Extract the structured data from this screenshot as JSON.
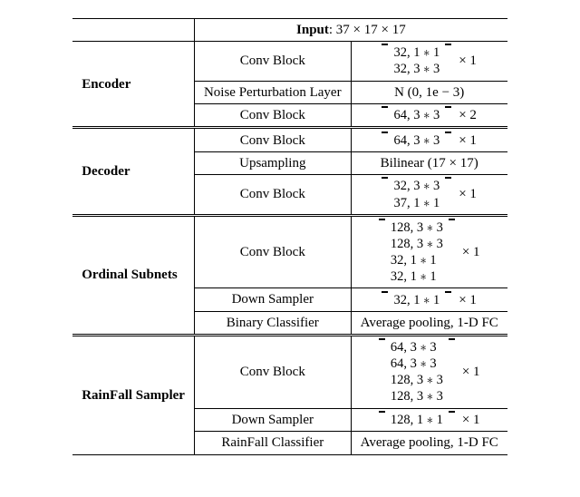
{
  "header": {
    "input_label": "Input",
    "input_dims": ": 37 × 17 × 17"
  },
  "sections": {
    "encoder": {
      "title": "Encoder",
      "rows": [
        {
          "op": "Conv Block",
          "mx": [
            "32, 1 ∗ 1",
            "32, 3 ∗ 3"
          ],
          "mult": "× 1"
        },
        {
          "op": "Noise Perturbation Layer",
          "txt": "N (0, 1e − 3)"
        },
        {
          "op": "Conv Block",
          "mx": [
            "64, 3 ∗ 3"
          ],
          "mult": "× 2"
        }
      ]
    },
    "decoder": {
      "title": "Decoder",
      "rows": [
        {
          "op": "Conv Block",
          "mx": [
            "64, 3 ∗ 3"
          ],
          "mult": "× 1"
        },
        {
          "op": "Upsampling",
          "txt": "Bilinear (17 × 17)"
        },
        {
          "op": "Conv Block",
          "mx": [
            "32, 3 ∗ 3",
            "37, 1 ∗ 1"
          ],
          "mult": "× 1"
        }
      ]
    },
    "ordinal": {
      "title": "Ordinal Subnets",
      "rows": [
        {
          "op": "Conv Block",
          "mx": [
            "128, 3 ∗ 3",
            "128, 3 ∗ 3",
            "32,  1 ∗ 1",
            "32,  1 ∗ 1"
          ],
          "mult": "× 1"
        },
        {
          "op": "Down Sampler",
          "mx": [
            "32, 1 ∗ 1"
          ],
          "mult": "× 1"
        },
        {
          "op": "Binary Classifier",
          "txt": "Average pooling, 1-D FC"
        }
      ]
    },
    "rainfall": {
      "title": "RainFall Sampler",
      "rows": [
        {
          "op": "Conv Block",
          "mx": [
            "64,  3 ∗ 3",
            "64,  3 ∗ 3",
            "128, 3 ∗ 3",
            "128, 3 ∗ 3"
          ],
          "mult": "× 1"
        },
        {
          "op": "Down Sampler",
          "mx": [
            "128, 1 ∗ 1"
          ],
          "mult": "× 1"
        },
        {
          "op": "RainFall Classifier",
          "txt": "Average pooling, 1-D FC"
        }
      ]
    }
  },
  "chart_data": {
    "type": "table",
    "title": "Network architecture table",
    "input": "37 × 17 × 17",
    "sections": [
      {
        "name": "Encoder",
        "layers": [
          {
            "op": "Conv Block",
            "kernels": [
              [
                32,
                "1*1"
              ],
              [
                32,
                "3*3"
              ]
            ],
            "repeat": 1
          },
          {
            "op": "Noise Perturbation Layer",
            "detail": "N(0, 1e-3)"
          },
          {
            "op": "Conv Block",
            "kernels": [
              [
                64,
                "3*3"
              ]
            ],
            "repeat": 2
          }
        ]
      },
      {
        "name": "Decoder",
        "layers": [
          {
            "op": "Conv Block",
            "kernels": [
              [
                64,
                "3*3"
              ]
            ],
            "repeat": 1
          },
          {
            "op": "Upsampling",
            "detail": "Bilinear (17 × 17)"
          },
          {
            "op": "Conv Block",
            "kernels": [
              [
                32,
                "3*3"
              ],
              [
                37,
                "1*1"
              ]
            ],
            "repeat": 1
          }
        ]
      },
      {
        "name": "Ordinal Subnets",
        "layers": [
          {
            "op": "Conv Block",
            "kernels": [
              [
                128,
                "3*3"
              ],
              [
                128,
                "3*3"
              ],
              [
                32,
                "1*1"
              ],
              [
                32,
                "1*1"
              ]
            ],
            "repeat": 1
          },
          {
            "op": "Down Sampler",
            "kernels": [
              [
                32,
                "1*1"
              ]
            ],
            "repeat": 1
          },
          {
            "op": "Binary Classifier",
            "detail": "Average pooling, 1-D FC"
          }
        ]
      },
      {
        "name": "RainFall Sampler",
        "layers": [
          {
            "op": "Conv Block",
            "kernels": [
              [
                64,
                "3*3"
              ],
              [
                64,
                "3*3"
              ],
              [
                128,
                "3*3"
              ],
              [
                128,
                "3*3"
              ]
            ],
            "repeat": 1
          },
          {
            "op": "Down Sampler",
            "kernels": [
              [
                128,
                "1*1"
              ]
            ],
            "repeat": 1
          },
          {
            "op": "RainFall Classifier",
            "detail": "Average pooling, 1-D FC"
          }
        ]
      }
    ]
  }
}
